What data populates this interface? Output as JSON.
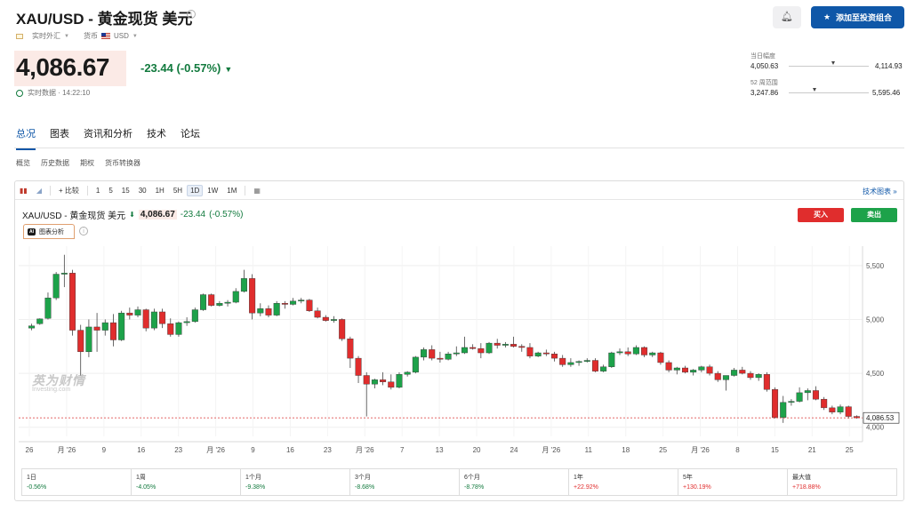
{
  "header": {
    "title": "XAU/USD - 黄金现货 美元",
    "market_label": "实时外汇",
    "currency_label": "货币",
    "currency_value": "USD",
    "price": "4,086.67",
    "change": "-23.44",
    "change_pct": "(-0.57%)",
    "realtime_text": "实时数据 · 14:22:10",
    "add_portfolio_label": "添加至投资组合",
    "day_range_label": "当日幅度",
    "day_low": "4,050.63",
    "day_high": "4,114.93",
    "week52_label": "52 周范围",
    "week52_low": "3,247.86",
    "week52_high": "5,595.46",
    "colors": {
      "up": "#1da24a",
      "down": "#e02d2d",
      "accent": "#0f57a8",
      "change": "#127a3e"
    },
    "icons": [
      "info-icon",
      "bell-plus-icon",
      "star-icon",
      "clock-icon",
      "us-flag-icon"
    ]
  },
  "tabs": [
    "总况",
    "图表",
    "资讯和分析",
    "技术",
    "论坛"
  ],
  "subtabs": [
    "概览",
    "历史数据",
    "期权",
    "货币转换器"
  ],
  "toolbar": {
    "compare_label": "+ 比较",
    "intervals": [
      "1",
      "5",
      "15",
      "30",
      "1H",
      "5H",
      "1D",
      "1W",
      "1M"
    ],
    "active_interval": "1D",
    "tech_chart_link": "技术图表 »"
  },
  "chart_header": {
    "symbol": "XAU/USD - 黄金现货 美元",
    "price": "4,086.67",
    "change": "-23.44",
    "change_pct": "(-0.57%)",
    "ai_label": "图表分析",
    "ai_badge": "AI",
    "buy_label": "买入",
    "sell_label": "卖出",
    "watermark_cn": "英为财情",
    "watermark_en": "Investing.com"
  },
  "chart_data": {
    "type": "candlestick",
    "y_ticks": [
      4000,
      4500,
      5000,
      5500
    ],
    "y_tick_labels": [
      "4,000",
      "4,500",
      "5,000",
      "5,500"
    ],
    "ylim": [
      3915,
      5680
    ],
    "current_price_label": "4,086.53",
    "current_price": 4086.53,
    "x_tick_labels": [
      "26",
      "月 '26",
      "9",
      "16",
      "23",
      "月 '26",
      "9",
      "16",
      "23",
      "月 '26",
      "7",
      "13",
      "20",
      "24",
      "月 '26",
      "11",
      "18",
      "25",
      "月 '26",
      "8",
      "15",
      "21",
      "25"
    ],
    "candles": [
      {
        "o": 4920,
        "h": 4960,
        "l": 4900,
        "c": 4940
      },
      {
        "o": 4960,
        "h": 5010,
        "l": 4950,
        "c": 5005
      },
      {
        "o": 5010,
        "h": 5250,
        "l": 5000,
        "c": 5200
      },
      {
        "o": 5200,
        "h": 5440,
        "l": 5180,
        "c": 5420
      },
      {
        "o": 5420,
        "h": 5600,
        "l": 5300,
        "c": 5430
      },
      {
        "o": 5430,
        "h": 5460,
        "l": 4850,
        "c": 4900
      },
      {
        "o": 4900,
        "h": 4950,
        "l": 4480,
        "c": 4700
      },
      {
        "o": 4700,
        "h": 5000,
        "l": 4650,
        "c": 4930
      },
      {
        "o": 4930,
        "h": 5060,
        "l": 4700,
        "c": 4900
      },
      {
        "o": 4900,
        "h": 5000,
        "l": 4850,
        "c": 4970
      },
      {
        "o": 4970,
        "h": 5050,
        "l": 4750,
        "c": 4810
      },
      {
        "o": 4810,
        "h": 5080,
        "l": 4800,
        "c": 5060
      },
      {
        "o": 5060,
        "h": 5110,
        "l": 5000,
        "c": 5040
      },
      {
        "o": 5040,
        "h": 5120,
        "l": 5020,
        "c": 5090
      },
      {
        "o": 5090,
        "h": 5100,
        "l": 4890,
        "c": 4920
      },
      {
        "o": 4920,
        "h": 5100,
        "l": 4900,
        "c": 5070
      },
      {
        "o": 5070,
        "h": 5100,
        "l": 4920,
        "c": 4960
      },
      {
        "o": 4960,
        "h": 5010,
        "l": 4840,
        "c": 4860
      },
      {
        "o": 4860,
        "h": 4980,
        "l": 4840,
        "c": 4970
      },
      {
        "o": 4970,
        "h": 5020,
        "l": 4940,
        "c": 4980
      },
      {
        "o": 4980,
        "h": 5110,
        "l": 4970,
        "c": 5090
      },
      {
        "o": 5090,
        "h": 5240,
        "l": 5080,
        "c": 5230
      },
      {
        "o": 5230,
        "h": 5240,
        "l": 5120,
        "c": 5130
      },
      {
        "o": 5130,
        "h": 5170,
        "l": 5120,
        "c": 5150
      },
      {
        "o": 5150,
        "h": 5180,
        "l": 5120,
        "c": 5160
      },
      {
        "o": 5160,
        "h": 5290,
        "l": 5150,
        "c": 5260
      },
      {
        "o": 5260,
        "h": 5460,
        "l": 5250,
        "c": 5380
      },
      {
        "o": 5380,
        "h": 5420,
        "l": 5000,
        "c": 5060
      },
      {
        "o": 5060,
        "h": 5150,
        "l": 5030,
        "c": 5100
      },
      {
        "o": 5100,
        "h": 5130,
        "l": 5020,
        "c": 5040
      },
      {
        "o": 5040,
        "h": 5170,
        "l": 5030,
        "c": 5150
      },
      {
        "o": 5150,
        "h": 5170,
        "l": 5100,
        "c": 5140
      },
      {
        "o": 5140,
        "h": 5200,
        "l": 5130,
        "c": 5170
      },
      {
        "o": 5170,
        "h": 5200,
        "l": 5150,
        "c": 5180
      },
      {
        "o": 5180,
        "h": 5190,
        "l": 5070,
        "c": 5080
      },
      {
        "o": 5080,
        "h": 5110,
        "l": 5010,
        "c": 5020
      },
      {
        "o": 5020,
        "h": 5040,
        "l": 4980,
        "c": 4990
      },
      {
        "o": 4990,
        "h": 5030,
        "l": 4970,
        "c": 5000
      },
      {
        "o": 5000,
        "h": 5010,
        "l": 4800,
        "c": 4820
      },
      {
        "o": 4820,
        "h": 4840,
        "l": 4550,
        "c": 4640
      },
      {
        "o": 4640,
        "h": 4660,
        "l": 4410,
        "c": 4480
      },
      {
        "o": 4480,
        "h": 4510,
        "l": 4100,
        "c": 4400
      },
      {
        "o": 4400,
        "h": 4450,
        "l": 4360,
        "c": 4440
      },
      {
        "o": 4440,
        "h": 4510,
        "l": 4390,
        "c": 4420
      },
      {
        "o": 4420,
        "h": 4490,
        "l": 4350,
        "c": 4370
      },
      {
        "o": 4370,
        "h": 4510,
        "l": 4360,
        "c": 4490
      },
      {
        "o": 4490,
        "h": 4520,
        "l": 4470,
        "c": 4510
      },
      {
        "o": 4510,
        "h": 4660,
        "l": 4500,
        "c": 4650
      },
      {
        "o": 4650,
        "h": 4740,
        "l": 4620,
        "c": 4720
      },
      {
        "o": 4720,
        "h": 4760,
        "l": 4620,
        "c": 4640
      },
      {
        "o": 4640,
        "h": 4700,
        "l": 4600,
        "c": 4630
      },
      {
        "o": 4630,
        "h": 4700,
        "l": 4620,
        "c": 4680
      },
      {
        "o": 4680,
        "h": 4750,
        "l": 4660,
        "c": 4690
      },
      {
        "o": 4690,
        "h": 4840,
        "l": 4680,
        "c": 4740
      },
      {
        "o": 4740,
        "h": 4770,
        "l": 4720,
        "c": 4730
      },
      {
        "o": 4730,
        "h": 4780,
        "l": 4640,
        "c": 4690
      },
      {
        "o": 4690,
        "h": 4790,
        "l": 4680,
        "c": 4780
      },
      {
        "o": 4780,
        "h": 4820,
        "l": 4730,
        "c": 4760
      },
      {
        "o": 4760,
        "h": 4790,
        "l": 4740,
        "c": 4770
      },
      {
        "o": 4770,
        "h": 4840,
        "l": 4740,
        "c": 4750
      },
      {
        "o": 4750,
        "h": 4770,
        "l": 4700,
        "c": 4740
      },
      {
        "o": 4740,
        "h": 4780,
        "l": 4640,
        "c": 4660
      },
      {
        "o": 4660,
        "h": 4700,
        "l": 4650,
        "c": 4690
      },
      {
        "o": 4690,
        "h": 4720,
        "l": 4660,
        "c": 4680
      },
      {
        "o": 4680,
        "h": 4700,
        "l": 4610,
        "c": 4640
      },
      {
        "o": 4640,
        "h": 4670,
        "l": 4560,
        "c": 4580
      },
      {
        "o": 4580,
        "h": 4640,
        "l": 4560,
        "c": 4600
      },
      {
        "o": 4600,
        "h": 4620,
        "l": 4570,
        "c": 4610
      },
      {
        "o": 4610,
        "h": 4640,
        "l": 4600,
        "c": 4620
      },
      {
        "o": 4620,
        "h": 4640,
        "l": 4510,
        "c": 4520
      },
      {
        "o": 4520,
        "h": 4580,
        "l": 4510,
        "c": 4560
      },
      {
        "o": 4560,
        "h": 4700,
        "l": 4550,
        "c": 4690
      },
      {
        "o": 4690,
        "h": 4730,
        "l": 4670,
        "c": 4700
      },
      {
        "o": 4700,
        "h": 4740,
        "l": 4660,
        "c": 4680
      },
      {
        "o": 4680,
        "h": 4760,
        "l": 4670,
        "c": 4740
      },
      {
        "o": 4740,
        "h": 4750,
        "l": 4650,
        "c": 4670
      },
      {
        "o": 4670,
        "h": 4700,
        "l": 4650,
        "c": 4690
      },
      {
        "o": 4690,
        "h": 4700,
        "l": 4580,
        "c": 4600
      },
      {
        "o": 4600,
        "h": 4620,
        "l": 4510,
        "c": 4530
      },
      {
        "o": 4530,
        "h": 4560,
        "l": 4490,
        "c": 4550
      },
      {
        "o": 4550,
        "h": 4570,
        "l": 4500,
        "c": 4510
      },
      {
        "o": 4510,
        "h": 4540,
        "l": 4480,
        "c": 4530
      },
      {
        "o": 4530,
        "h": 4570,
        "l": 4510,
        "c": 4560
      },
      {
        "o": 4560,
        "h": 4580,
        "l": 4480,
        "c": 4500
      },
      {
        "o": 4500,
        "h": 4520,
        "l": 4420,
        "c": 4440
      },
      {
        "o": 4440,
        "h": 4480,
        "l": 4340,
        "c": 4480
      },
      {
        "o": 4480,
        "h": 4550,
        "l": 4470,
        "c": 4530
      },
      {
        "o": 4530,
        "h": 4560,
        "l": 4490,
        "c": 4500
      },
      {
        "o": 4500,
        "h": 4520,
        "l": 4440,
        "c": 4460
      },
      {
        "o": 4460,
        "h": 4500,
        "l": 4430,
        "c": 4490
      },
      {
        "o": 4490,
        "h": 4510,
        "l": 4330,
        "c": 4350
      },
      {
        "o": 4350,
        "h": 4370,
        "l": 4080,
        "c": 4090
      },
      {
        "o": 4090,
        "h": 4290,
        "l": 4040,
        "c": 4230
      },
      {
        "o": 4230,
        "h": 4260,
        "l": 4200,
        "c": 4240
      },
      {
        "o": 4240,
        "h": 4370,
        "l": 4230,
        "c": 4320
      },
      {
        "o": 4320,
        "h": 4360,
        "l": 4250,
        "c": 4340
      },
      {
        "o": 4340,
        "h": 4380,
        "l": 4250,
        "c": 4260
      },
      {
        "o": 4260,
        "h": 4280,
        "l": 4160,
        "c": 4180
      },
      {
        "o": 4180,
        "h": 4200,
        "l": 4120,
        "c": 4140
      },
      {
        "o": 4140,
        "h": 4210,
        "l": 4120,
        "c": 4190
      },
      {
        "o": 4190,
        "h": 4200,
        "l": 4080,
        "c": 4100
      },
      {
        "o": 4100,
        "h": 4110,
        "l": 4080,
        "c": 4087
      }
    ]
  },
  "performance": [
    {
      "label": "1日",
      "value": "-0.56%",
      "dir": "neg"
    },
    {
      "label": "1周",
      "value": "-4.05%",
      "dir": "neg"
    },
    {
      "label": "1个月",
      "value": "-9.38%",
      "dir": "neg"
    },
    {
      "label": "3个月",
      "value": "-8.68%",
      "dir": "neg"
    },
    {
      "label": "6个月",
      "value": "-8.78%",
      "dir": "neg"
    },
    {
      "label": "1年",
      "value": "+22.92%",
      "dir": "pos"
    },
    {
      "label": "5年",
      "value": "+130.19%",
      "dir": "pos"
    },
    {
      "label": "最大值",
      "value": "+718.88%",
      "dir": "pos"
    }
  ]
}
